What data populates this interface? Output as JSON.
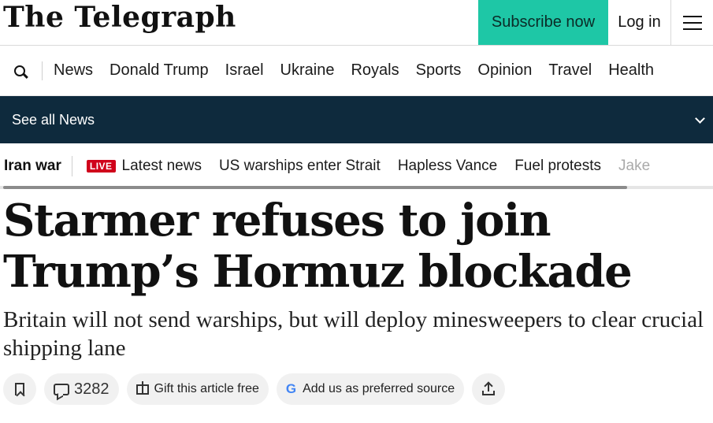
{
  "header": {
    "logo": "The Telegraph",
    "subscribe_label": "Subscribe now",
    "login_label": "Log in"
  },
  "nav": {
    "items": [
      {
        "label": "News"
      },
      {
        "label": "Donald Trump"
      },
      {
        "label": "Israel"
      },
      {
        "label": "Ukraine"
      },
      {
        "label": "Royals"
      },
      {
        "label": "Sports"
      },
      {
        "label": "Opinion"
      },
      {
        "label": "Travel"
      },
      {
        "label": "Health"
      }
    ]
  },
  "section_bar": {
    "label": "See all News"
  },
  "topic_bar": {
    "main": "Iran war",
    "live_badge": "LIVE",
    "items": [
      {
        "label": "Latest news"
      },
      {
        "label": "US warships enter Strait"
      },
      {
        "label": "Hapless Vance"
      },
      {
        "label": "Fuel protests"
      },
      {
        "label": "Jake"
      }
    ]
  },
  "article": {
    "headline": "Starmer refuses to join Trump’s Hormuz blockade",
    "standfirst": "Britain will not send warships, but will deploy minesweepers to clear crucial shipping lane"
  },
  "actions": {
    "comment_count": "3282",
    "gift_label": "Gift this article free",
    "google_glyph": "G",
    "preferred_source_label": "Add us as preferred source"
  },
  "colors": {
    "subscribe_bg": "#1ec7a6",
    "section_bar_bg": "#0e2a3d",
    "live_red": "#d0021b"
  }
}
